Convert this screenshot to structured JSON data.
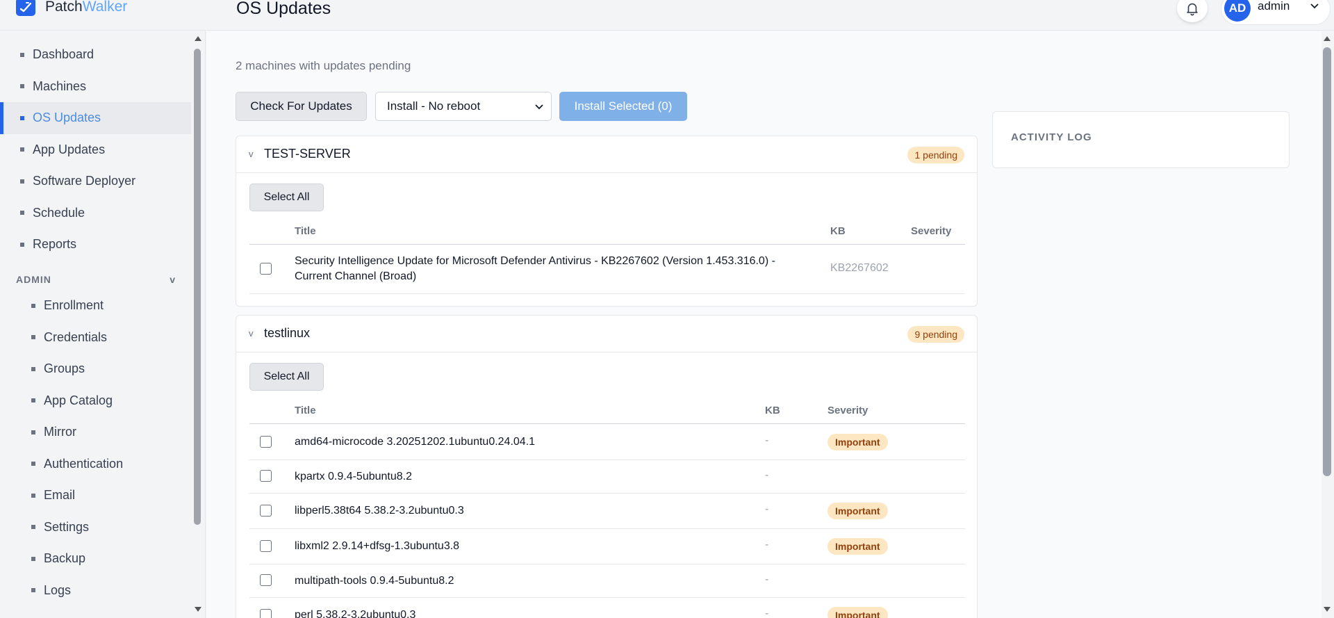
{
  "brand": {
    "part1": "Patch",
    "part2": "Walker"
  },
  "page": {
    "title": "OS Updates"
  },
  "user": {
    "initials": "AD",
    "name": "admin"
  },
  "nav": {
    "items": [
      {
        "label": "Dashboard"
      },
      {
        "label": "Machines"
      },
      {
        "label": "OS Updates",
        "active": true
      },
      {
        "label": "App Updates"
      },
      {
        "label": "Software Deployer"
      },
      {
        "label": "Schedule"
      },
      {
        "label": "Reports"
      }
    ],
    "admin_header": "ADMIN",
    "admin_toggle": "v",
    "admin_items": [
      {
        "label": "Enrollment"
      },
      {
        "label": "Credentials"
      },
      {
        "label": "Groups"
      },
      {
        "label": "App Catalog"
      },
      {
        "label": "Mirror"
      },
      {
        "label": "Authentication"
      },
      {
        "label": "Email"
      },
      {
        "label": "Settings"
      },
      {
        "label": "Backup"
      },
      {
        "label": "Logs"
      }
    ]
  },
  "toolbar": {
    "summary": "2 machines with updates pending",
    "check_label": "Check For Updates",
    "install_mode": "Install - No reboot",
    "install_label": "Install Selected (0)"
  },
  "columns": {
    "title": "Title",
    "kb": "KB",
    "severity": "Severity"
  },
  "machines": [
    {
      "name": "TEST-SERVER",
      "caret": "v",
      "pending": "1 pending",
      "select_all": "Select All",
      "updates": [
        {
          "title_line1": "Security Intelligence Update for Microsoft Defender Antivirus - KB2267602 (Version 1.453.316.0) -",
          "title_line2": "Current Channel (Broad)",
          "kb": "KB2267602",
          "severity": ""
        }
      ]
    },
    {
      "name": "testlinux",
      "caret": "v",
      "pending": "9 pending",
      "select_all": "Select All",
      "updates": [
        {
          "title": "amd64-microcode 3.20251202.1ubuntu0.24.04.1",
          "kb": "-",
          "severity": "Important"
        },
        {
          "title": "kpartx 0.9.4-5ubuntu8.2",
          "kb": "-",
          "severity": ""
        },
        {
          "title": "libperl5.38t64 5.38.2-3.2ubuntu0.3",
          "kb": "-",
          "severity": "Important"
        },
        {
          "title": "libxml2 2.9.14+dfsg-1.3ubuntu3.8",
          "kb": "-",
          "severity": "Important"
        },
        {
          "title": "multipath-tools 0.9.4-5ubuntu8.2",
          "kb": "-",
          "severity": ""
        },
        {
          "title": "perl 5.38.2-3.2ubuntu0.3",
          "kb": "-",
          "severity": "Important"
        }
      ]
    }
  ],
  "activity": {
    "title": "ACTIVITY LOG"
  },
  "colors": {
    "accent": "#2563eb",
    "badge_bg": "#fde7c2",
    "badge_text": "#92400e"
  }
}
